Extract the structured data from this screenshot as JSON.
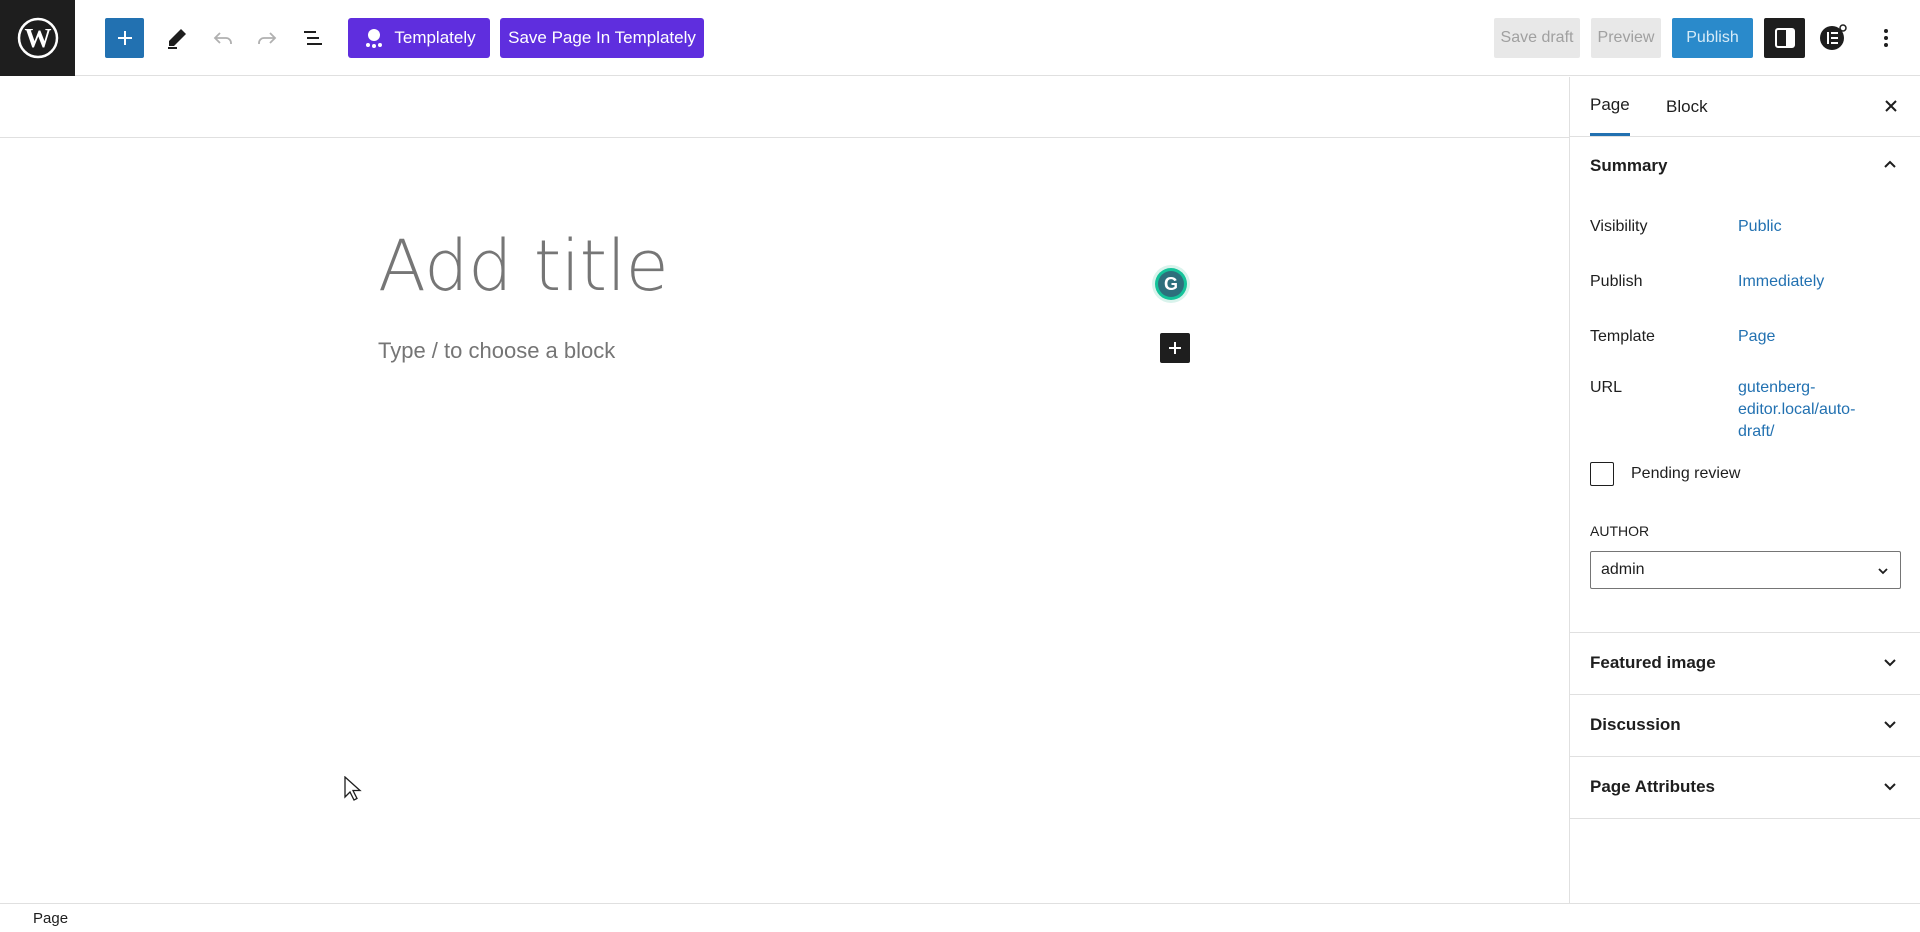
{
  "toolbar": {
    "templately_label": "Templately",
    "save_in_templately_label": "Save Page In Templately",
    "save_draft_label": "Save draft",
    "preview_label": "Preview",
    "publish_label": "Publish"
  },
  "editor": {
    "title_placeholder": "Add title",
    "block_placeholder": "Type / to choose a block",
    "grammarly_letter": "G"
  },
  "sidebar": {
    "tabs": [
      {
        "label": "Page",
        "active": true
      },
      {
        "label": "Block",
        "active": false
      }
    ],
    "summary": {
      "title": "Summary",
      "rows": [
        {
          "label": "Visibility",
          "value": "Public"
        },
        {
          "label": "Publish",
          "value": "Immediately"
        },
        {
          "label": "Template",
          "value": "Page"
        },
        {
          "label": "URL",
          "value_lines": [
            "gutenberg-",
            "editor.local/auto-",
            "draft/"
          ]
        }
      ],
      "pending_review_label": "Pending review",
      "pending_review_checked": false,
      "author_label": "AUTHOR",
      "author_value": "admin"
    },
    "panels": [
      {
        "title": "Featured image"
      },
      {
        "title": "Discussion"
      },
      {
        "title": "Page Attributes"
      }
    ]
  },
  "footer": {
    "breadcrumb": "Page"
  },
  "colors": {
    "accent": "#2271b1",
    "templately": "#5f2ede",
    "dark": "#1e1e1e"
  }
}
